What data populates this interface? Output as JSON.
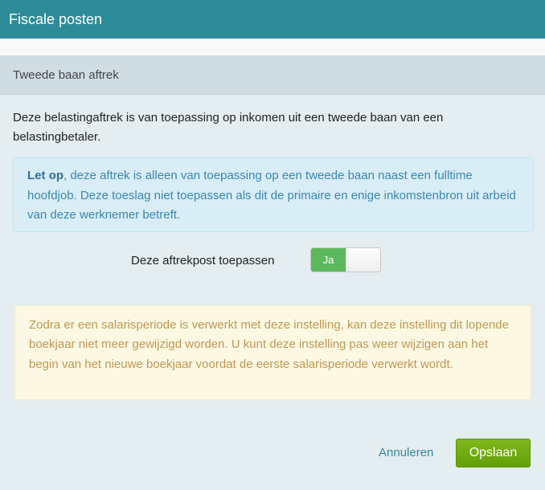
{
  "dialog": {
    "title": "Fiscale posten"
  },
  "section": {
    "title": "Tweede baan aftrek"
  },
  "description": "Deze belastingaftrek is van toepassing op inkomen uit een tweede baan van een belastingbetaler.",
  "info": {
    "emphasis": "Let op",
    "text": ", deze aftrek is alleen van toepassing op een tweede baan naast een fulltime hoofdjob. Deze toeslag niet toepassen als dit de primaire en enige inkomstenbron uit arbeid van deze werknemer betreft."
  },
  "toggle": {
    "label": "Deze aftrekpost toepassen",
    "on_label": "Ja",
    "state": "on",
    "on_color": "#5cb85c"
  },
  "warning": {
    "text": "Zodra er een salarisperiode is verwerkt met deze instelling, kan deze instelling dit lopende boekjaar niet meer gewijzigd worden. U kunt deze instelling pas weer wijzigen aan het begin van het nieuwe boekjaar voordat de eerste salarisperiode verwerkt wordt."
  },
  "actions": {
    "cancel_label": "Annuleren",
    "save_label": "Opslaan"
  },
  "colors": {
    "header": "#2e8b98",
    "info_text": "#3a87ad",
    "warning_text": "#c09853",
    "save_button": "#6aa810"
  }
}
